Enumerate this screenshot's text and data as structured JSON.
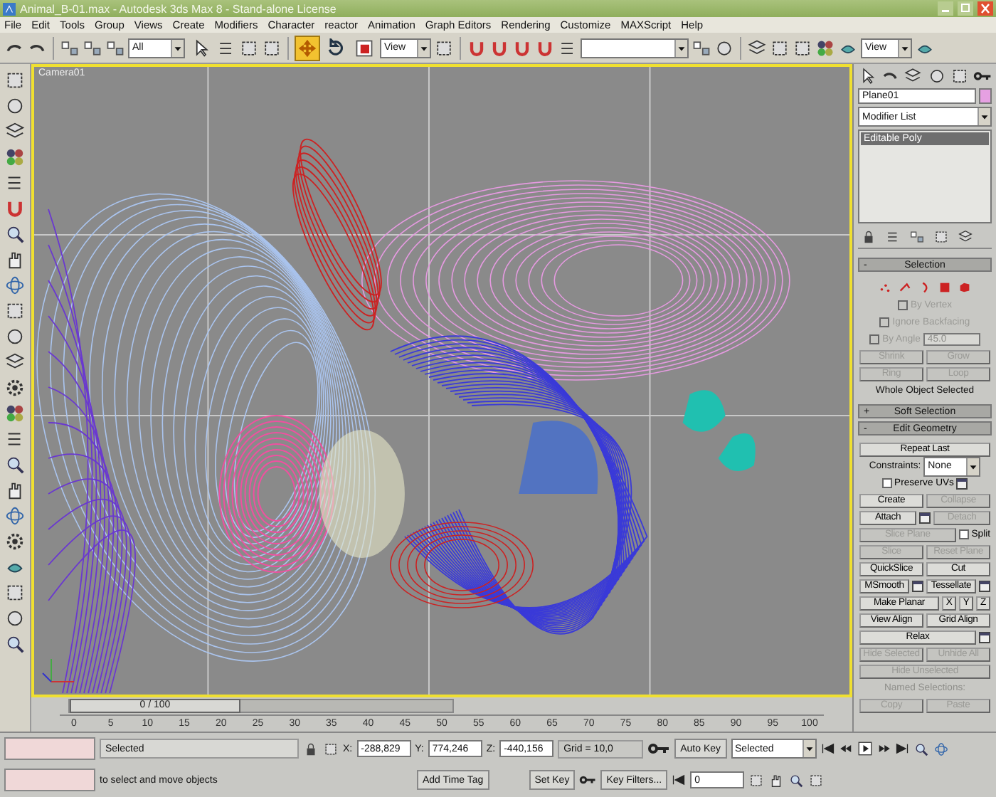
{
  "window": {
    "title": "Animal_B-01.max - Autodesk 3ds Max 8 - Stand-alone License"
  },
  "menu": [
    "File",
    "Edit",
    "Tools",
    "Group",
    "Views",
    "Create",
    "Modifiers",
    "Character",
    "reactor",
    "Animation",
    "Graph Editors",
    "Rendering",
    "Customize",
    "MAXScript",
    "Help"
  ],
  "toolbar": {
    "selection_filter": "All",
    "reference_coord": "View",
    "render_type": "View",
    "tools": [
      {
        "kind": "select",
        "selected": false
      },
      {
        "kind": "move",
        "selected": true
      },
      {
        "kind": "rotate",
        "selected": false
      },
      {
        "kind": "scale",
        "selected": false
      }
    ]
  },
  "viewport": {
    "label": "Camera01"
  },
  "time_slider": {
    "position": "0 / 100"
  },
  "ruler": [
    "0",
    "5",
    "10",
    "15",
    "20",
    "25",
    "30",
    "35",
    "40",
    "45",
    "50",
    "55",
    "60",
    "65",
    "70",
    "75",
    "80",
    "85",
    "90",
    "95",
    "100"
  ],
  "command_panel": {
    "object_name": "Plane01",
    "modifier_list": "Modifier List",
    "stack": [
      {
        "label": "Editable Poly",
        "selected": true
      }
    ],
    "rollouts": [
      {
        "sign": "-",
        "title": "Selection",
        "subobject_levels": [
          {
            "kind": "vertex",
            "selected": false
          },
          {
            "kind": "edge",
            "selected": false
          },
          {
            "kind": "border",
            "selected": false
          },
          {
            "kind": "polygon",
            "selected": false
          },
          {
            "kind": "element",
            "selected": false
          }
        ],
        "lines": [
          {
            "items": [
              {
                "kind": "checkbox",
                "label": "By Vertex",
                "checked": false,
                "disabled": true
              }
            ]
          },
          {
            "items": [
              {
                "kind": "checkbox",
                "label": "Ignore Backfacing",
                "checked": false,
                "disabled": true
              }
            ]
          },
          {
            "items": [
              {
                "kind": "checkbox",
                "label": "By Angle",
                "checked": false,
                "disabled": true
              },
              {
                "kind": "spinner",
                "value": "45.0",
                "disabled": true
              }
            ]
          },
          {
            "items": [
              {
                "kind": "button",
                "label": "Shrink",
                "disabled": true
              },
              {
                "kind": "button",
                "label": "Grow",
                "disabled": true
              }
            ]
          },
          {
            "items": [
              {
                "kind": "spin_button",
                "label": "Ring",
                "disabled": true
              },
              {
                "kind": "spin_button",
                "label": "Loop",
                "disabled": true
              }
            ]
          },
          {
            "items": [
              {
                "kind": "text",
                "label": "Whole Object Selected",
                "disabled": false
              }
            ]
          }
        ]
      },
      {
        "sign": "+",
        "title": "Soft Selection"
      },
      {
        "sign": "-",
        "title": "Edit Geometry",
        "lines": [
          {
            "items": [
              {
                "kind": "button",
                "label": "Repeat Last",
                "disabled": false
              }
            ]
          },
          {
            "items": [
              {
                "kind": "text",
                "label": "Constraints:",
                "disabled": false
              },
              {
                "kind": "dropdown",
                "value": "None"
              }
            ]
          },
          {
            "items": [
              {
                "kind": "checkbox",
                "label": "Preserve UVs",
                "checked": false,
                "disabled": false,
                "settings": true
              }
            ]
          },
          {
            "items": [
              {
                "kind": "button",
                "label": "Create",
                "disabled": false
              },
              {
                "kind": "button",
                "label": "Collapse",
                "disabled": true
              }
            ]
          },
          {
            "items": [
              {
                "kind": "button",
                "label": "Attach",
                "disabled": false,
                "settings": true
              },
              {
                "kind": "button",
                "label": "Detach",
                "disabled": true
              }
            ]
          },
          {
            "items": [
              {
                "kind": "button",
                "label": "Slice Plane",
                "disabled": true
              },
              {
                "kind": "checkbox",
                "label": "Split",
                "checked": false,
                "disabled": false
              }
            ]
          },
          {
            "items": [
              {
                "kind": "button",
                "label": "Slice",
                "disabled": true
              },
              {
                "kind": "button",
                "label": "Reset Plane",
                "disabled": true
              }
            ]
          },
          {
            "items": [
              {
                "kind": "button",
                "label": "QuickSlice",
                "disabled": false
              },
              {
                "kind": "button",
                "label": "Cut",
                "disabled": false
              }
            ]
          },
          {
            "items": [
              {
                "kind": "button",
                "label": "MSmooth",
                "disabled": false,
                "settings": true
              },
              {
                "kind": "button",
                "label": "Tessellate",
                "disabled": false,
                "settings": true
              }
            ]
          },
          {
            "items": [
              {
                "kind": "button",
                "label": "Make Planar",
                "disabled": false
              },
              {
                "kind": "axis_button",
                "label": "X",
                "disabled": false
              },
              {
                "kind": "axis_button",
                "label": "Y",
                "disabled": false
              },
              {
                "kind": "axis_button",
                "label": "Z",
                "disabled": false
              }
            ]
          },
          {
            "items": [
              {
                "kind": "button",
                "label": "View Align",
                "disabled": false
              },
              {
                "kind": "button",
                "label": "Grid Align",
                "disabled": false
              }
            ]
          },
          {
            "items": [
              {
                "kind": "button",
                "label": "Relax",
                "disabled": false,
                "settings": true
              }
            ]
          },
          {
            "items": [
              {
                "kind": "button",
                "label": "Hide Selected",
                "disabled": true
              },
              {
                "kind": "button",
                "label": "Unhide All",
                "disabled": true
              }
            ]
          },
          {
            "items": [
              {
                "kind": "button",
                "label": "Hide Unselected",
                "disabled": true
              }
            ]
          },
          {
            "items": [
              {
                "kind": "text",
                "label": "Named Selections:",
                "disabled": true
              }
            ]
          },
          {
            "items": [
              {
                "kind": "button",
                "label": "Copy",
                "disabled": true
              },
              {
                "kind": "button",
                "label": "Paste",
                "disabled": true
              }
            ]
          }
        ]
      }
    ]
  },
  "status_bar": {
    "selection": "Selected",
    "prompt": "to select and move objects",
    "coords": [
      {
        "axis": "X:",
        "value": "-288,829"
      },
      {
        "axis": "Y:",
        "value": "774,246"
      },
      {
        "axis": "Z:",
        "value": "-440,156"
      }
    ],
    "grid": "Grid = 10,0",
    "add_time_tag": "Add Time Tag",
    "auto_key": "Auto Key",
    "key_mode": "Selected",
    "set_key": "Set Key",
    "key_filters": "Key Filters...",
    "frame": "0"
  }
}
